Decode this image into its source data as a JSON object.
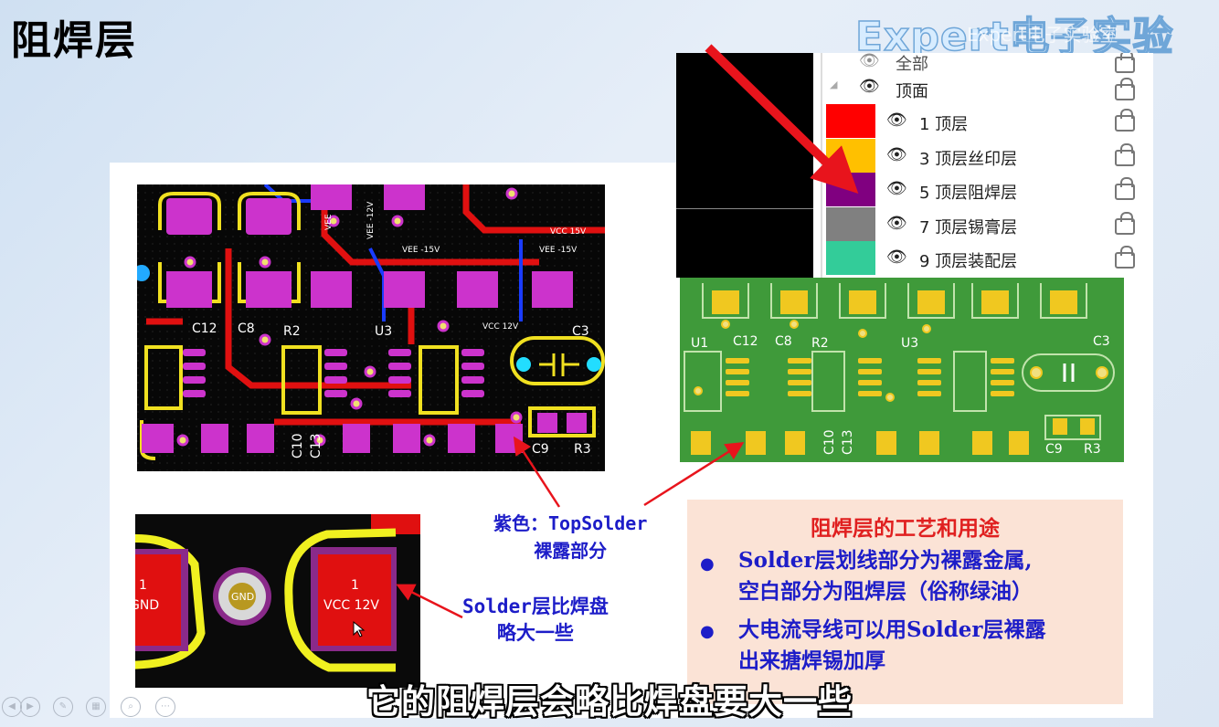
{
  "slide_title": "阻焊层",
  "watermark": "Expert电子实验",
  "watermark_small": "Expert电子实验室",
  "layer_panel": {
    "partial_top_label": "全部",
    "group_label": "顶面",
    "layers": [
      {
        "label": "1 顶层",
        "color": "#ff0000"
      },
      {
        "label": "3 顶层丝印层",
        "color": "#ffc000"
      },
      {
        "label": "5 顶层阻焊层",
        "color": "#800080"
      },
      {
        "label": "7 顶层锡膏层",
        "color": "#808080"
      },
      {
        "label": "9 顶层装配层",
        "color": "#33cc99"
      }
    ]
  },
  "pcb_main": {
    "labels": [
      "C12",
      "C8",
      "R2",
      "U3",
      "C3",
      "C10",
      "C13",
      "C9",
      "R3"
    ],
    "net_labels": [
      "VCC 15V",
      "VEE -15V",
      "VEE -15V",
      "VEE",
      "VEE -12V",
      "VCC 12V"
    ]
  },
  "pcb_green": {
    "labels": [
      "U1",
      "C12",
      "C8",
      "R2",
      "U3",
      "C3",
      "C10",
      "C13",
      "C9",
      "R3"
    ]
  },
  "pcb_zoom": {
    "pad_left_num": "1",
    "pad_left_net": "GND",
    "via_label": "GND",
    "pad_right_num": "1",
    "pad_right_net": "VCC 12V"
  },
  "callout_purple": {
    "line1": "紫色：TopSolder",
    "line2": "裸露部分"
  },
  "callout_solder": {
    "line1": "Solder层比焊盘",
    "line2": "略大一些"
  },
  "info_box": {
    "title": "阻焊层的工艺和用途",
    "bullets": [
      {
        "line1": "Solder层划线部分为裸露金属,",
        "line2": "空白部分为阻焊层（俗称绿油）"
      },
      {
        "line1": "大电流导线可以用Solder层裸露",
        "line2": "出来搪焊锡加厚"
      }
    ]
  },
  "subtitle": "它的阻焊层会略比焊盘要大一些",
  "colors": {
    "accent_red": "#e02020",
    "text_blue": "#1d1dc8",
    "solder_purple": "#cc33cc",
    "pcb_green": "#3f9a3a"
  }
}
